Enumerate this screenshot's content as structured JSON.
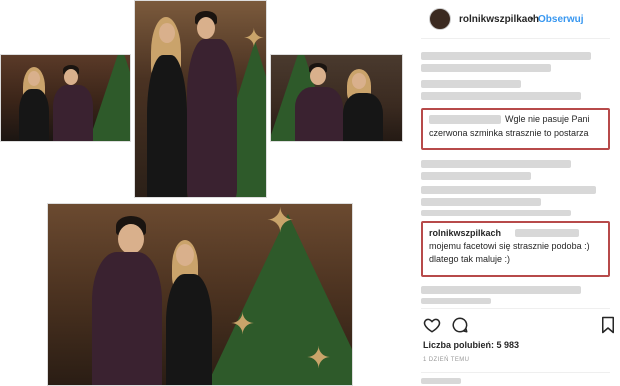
{
  "post": {
    "username": "rolnikwszpilkach",
    "separator": "•",
    "follow_label": "Obserwuj"
  },
  "comments": [
    {
      "text_line1": "Wgle nie pasuje Pani",
      "text_line2": "czerwona szminka strasznie to postarza"
    },
    {
      "user": "rolnikwszpilkach",
      "text_line1": "mojemu facetowi się strasznie podoba :)",
      "text_line2": "dlatego tak maluje :)"
    }
  ],
  "actions": {
    "like_icon": "heart-icon",
    "comment_icon": "comment-icon",
    "save_icon": "bookmark-icon"
  },
  "stats": {
    "likes_label": "Liczba polubień: 5 983",
    "time_ago": "1 DZIEŃ TEMU"
  },
  "colors": {
    "highlight_border": "#b74a4a",
    "follow_blue": "#3897f0"
  }
}
